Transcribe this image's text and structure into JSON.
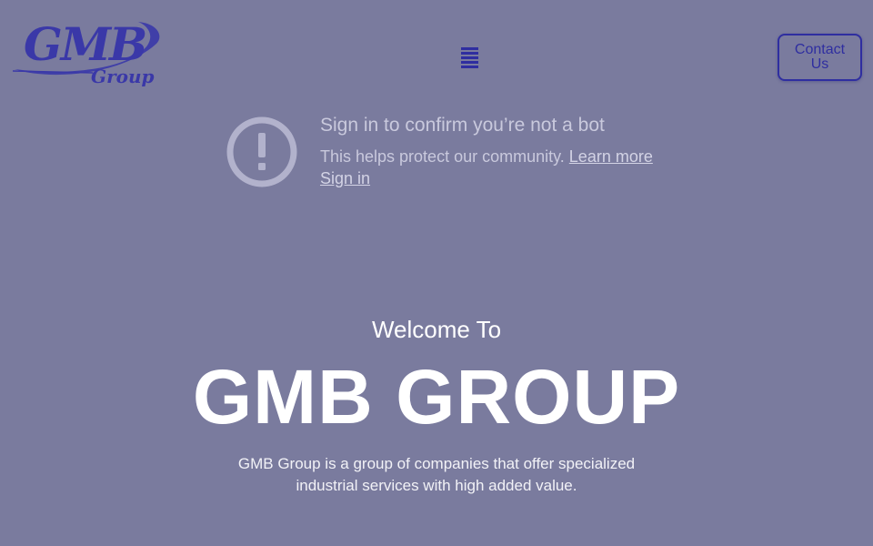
{
  "header": {
    "logo": {
      "main": "GMB",
      "sub": "Group"
    },
    "menu_icon": "hamburger-menu-icon",
    "contact_label": "Contact Us"
  },
  "notice": {
    "icon": "exclamation-circle-icon",
    "title": "Sign in to confirm you’re not a bot",
    "body": "This helps protect our community.",
    "learn_more": "Learn more",
    "sign_in": "Sign in"
  },
  "hero": {
    "welcome": "Welcome To",
    "title": "GMB GROUP",
    "description": "GMB Group is a group of companies that offer specialized industrial services with high added value."
  },
  "colors": {
    "background": "#7a7b9e",
    "brand": "#2f2ea0",
    "logo": "#3a38a8",
    "notice_text": "#c9c9dd",
    "hero_text": "#ffffff"
  }
}
